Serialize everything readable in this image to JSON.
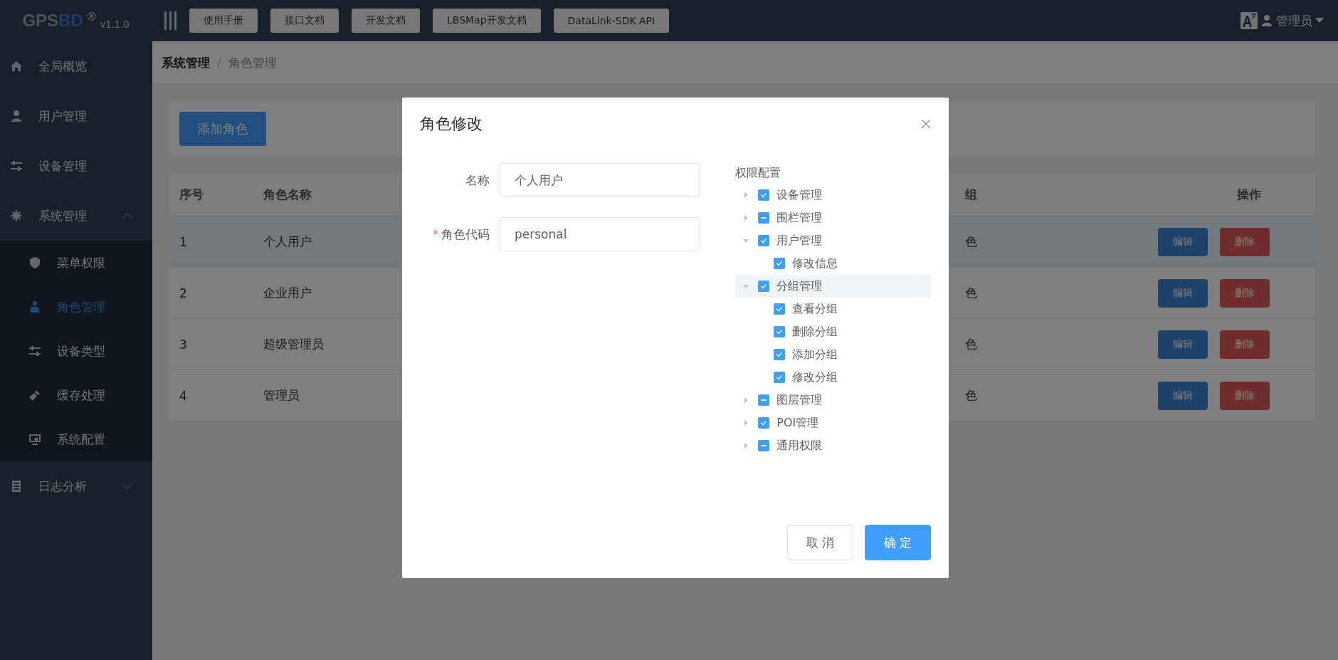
{
  "logo": {
    "parts": [
      "GPS",
      "BD"
    ],
    "mark": "®",
    "version": "v1.1.0"
  },
  "top_nav": {
    "buttons": [
      "使用手册",
      "接口文档",
      "开发文档",
      "LBSMap开发文档",
      "DataLink-SDK API"
    ],
    "user": "管理员"
  },
  "sidebar": {
    "items": [
      {
        "label": "全局概览",
        "selected": false
      },
      {
        "label": "用户管理",
        "selected": false
      },
      {
        "label": "设备管理",
        "selected": false
      },
      {
        "label": "系统管理",
        "selected": false,
        "expanded": true,
        "children": [
          {
            "label": "菜单权限",
            "selected": false
          },
          {
            "label": "角色管理",
            "selected": true
          },
          {
            "label": "设备类型",
            "selected": false
          },
          {
            "label": "缓存处理",
            "selected": false
          },
          {
            "label": "系统配置",
            "selected": false
          }
        ]
      },
      {
        "label": "日志分析",
        "selected": false,
        "expanded": false
      }
    ]
  },
  "breadcrumb": {
    "items": [
      "系统管理",
      "角色管理"
    ],
    "separator": "/"
  },
  "add_button": "添加角色",
  "table": {
    "columns": [
      "序号",
      "角色名称",
      "组",
      "操作"
    ],
    "rows": [
      {
        "cells": [
          "1",
          "个人用户",
          "色"
        ],
        "selected": true,
        "actions": [
          {
            "label": "编辑",
            "kind": "primary"
          },
          {
            "label": "删除",
            "kind": "danger"
          }
        ]
      },
      {
        "cells": [
          "2",
          "企业用户",
          "色"
        ],
        "selected": false,
        "actions": [
          {
            "label": "编辑",
            "kind": "primary"
          },
          {
            "label": "删除",
            "kind": "danger"
          }
        ]
      },
      {
        "cells": [
          "3",
          "超级管理员",
          "色"
        ],
        "selected": false,
        "actions": [
          {
            "label": "编辑",
            "kind": "primary"
          },
          {
            "label": "删除",
            "kind": "danger"
          }
        ]
      },
      {
        "cells": [
          "4",
          "管理员",
          "色"
        ],
        "selected": false,
        "actions": [
          {
            "label": "编辑",
            "kind": "primary"
          },
          {
            "label": "删除",
            "kind": "danger"
          }
        ]
      }
    ]
  },
  "dialog": {
    "title": "角色修改",
    "fields": [
      {
        "label": "名称",
        "value": "个人用户"
      },
      {
        "label": "角色代码",
        "value": "personal",
        "marker": "*"
      }
    ],
    "tree_label": "权限配置",
    "tree": [
      {
        "label": "设备管理",
        "checked": true,
        "indeterminate": false,
        "expanded": false,
        "selected": false
      },
      {
        "label": "围栏管理",
        "checked": false,
        "indeterminate": true,
        "expanded": false,
        "selected": false
      },
      {
        "label": "用户管理",
        "checked": true,
        "indeterminate": false,
        "expanded": true,
        "selected": false,
        "children": [
          {
            "label": "修改信息",
            "checked": true,
            "indeterminate": false,
            "selected": false
          }
        ]
      },
      {
        "label": "分组管理",
        "checked": true,
        "indeterminate": false,
        "expanded": true,
        "selected": true,
        "children": [
          {
            "label": "查看分组",
            "checked": true,
            "indeterminate": false,
            "selected": false
          },
          {
            "label": "删除分组",
            "checked": true,
            "indeterminate": false,
            "selected": false
          },
          {
            "label": "添加分组",
            "checked": true,
            "indeterminate": false,
            "selected": false
          },
          {
            "label": "修改分组",
            "checked": true,
            "indeterminate": false,
            "selected": false
          }
        ]
      },
      {
        "label": "图层管理",
        "checked": false,
        "indeterminate": true,
        "expanded": false,
        "selected": false
      },
      {
        "label": "POI管理",
        "checked": true,
        "indeterminate": false,
        "expanded": false,
        "selected": false
      },
      {
        "label": "通用权限",
        "checked": false,
        "indeterminate": true,
        "expanded": false,
        "selected": false
      }
    ],
    "buttons": [
      {
        "label": "取 消",
        "kind": "default"
      },
      {
        "label": "确 定",
        "kind": "primary"
      }
    ]
  }
}
